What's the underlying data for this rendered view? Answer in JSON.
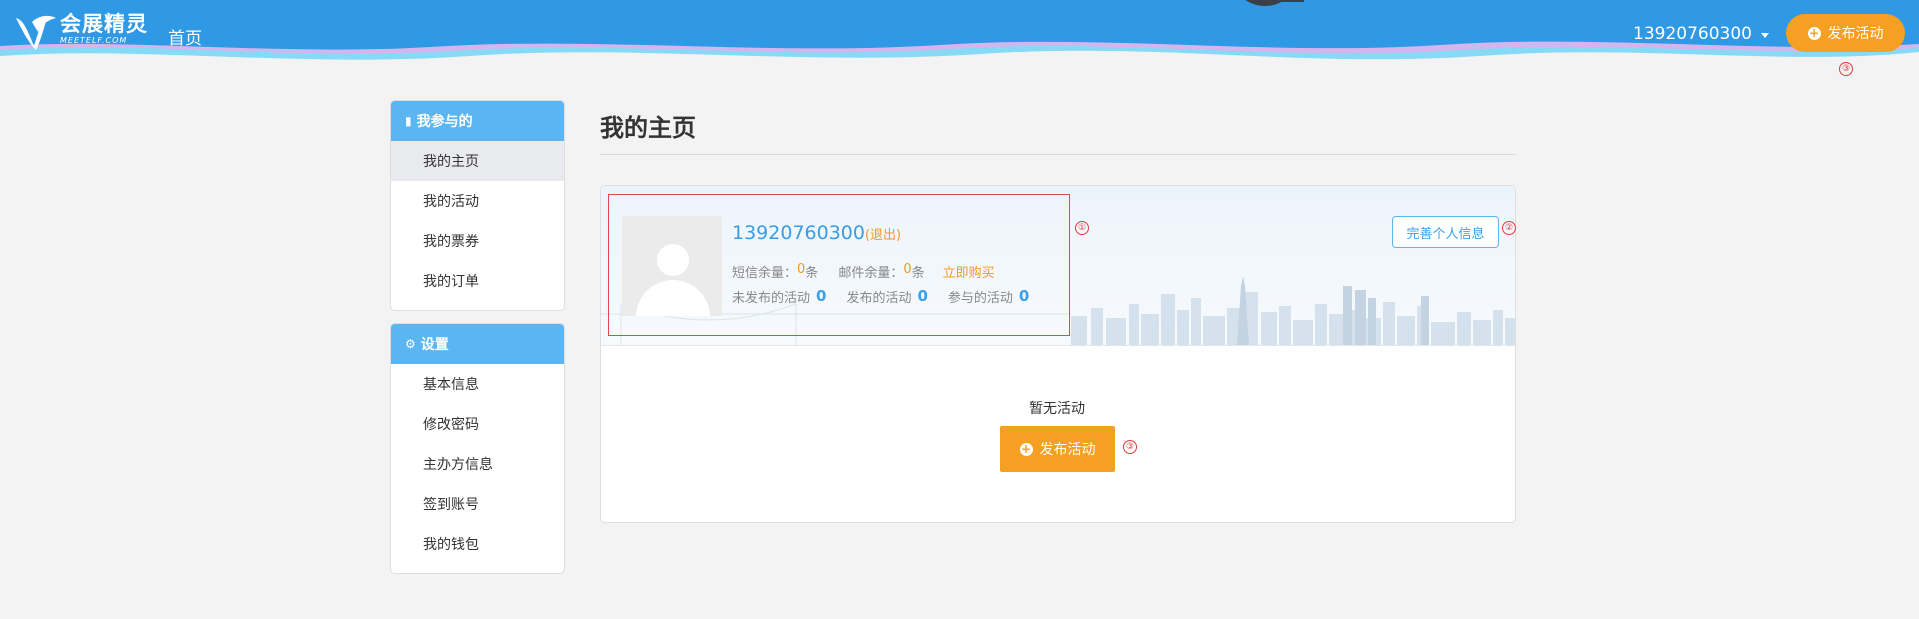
{
  "header": {
    "logo_cn": "会展精灵",
    "logo_en": "MEETELF.COM",
    "nav_home": "首页",
    "user_phone": "13920760300",
    "publish_label": "发布活动",
    "publish_icon": "plus-circle-icon",
    "marker_publish": "③",
    "colors": {
      "header_blue": "#2f99e6",
      "accent_orange": "#f6a023"
    }
  },
  "sidebar": {
    "sections": [
      {
        "title": "我参与的",
        "icon": "bookmark-icon",
        "items": [
          "我的主页",
          "我的活动",
          "我的票券",
          "我的订单"
        ],
        "active": "我的主页"
      },
      {
        "title": "设置",
        "icon": "gear-icon",
        "items": [
          "基本信息",
          "修改密码",
          "主办方信息",
          "签到账号",
          "我的钱包"
        ]
      }
    ]
  },
  "main": {
    "title": "我的主页",
    "profile": {
      "username": "13920760300",
      "logout": "(退出)",
      "sms_label": "短信余量：",
      "sms_count": "0",
      "sms_unit": "条",
      "mail_label": "邮件余量：",
      "mail_count": "0",
      "mail_unit": "条",
      "buy_link": "立即购买",
      "unpublished_label": "未发布的活动",
      "unpublished_count": "0",
      "published_label": "发布的活动",
      "published_count": "0",
      "joined_label": "参与的活动",
      "joined_count": "0",
      "marker": "①"
    },
    "complete_button": "完善个人信息",
    "complete_marker": "②",
    "empty_text": "暂无活动",
    "publish_button": "发布活动",
    "publish_marker": "③"
  }
}
